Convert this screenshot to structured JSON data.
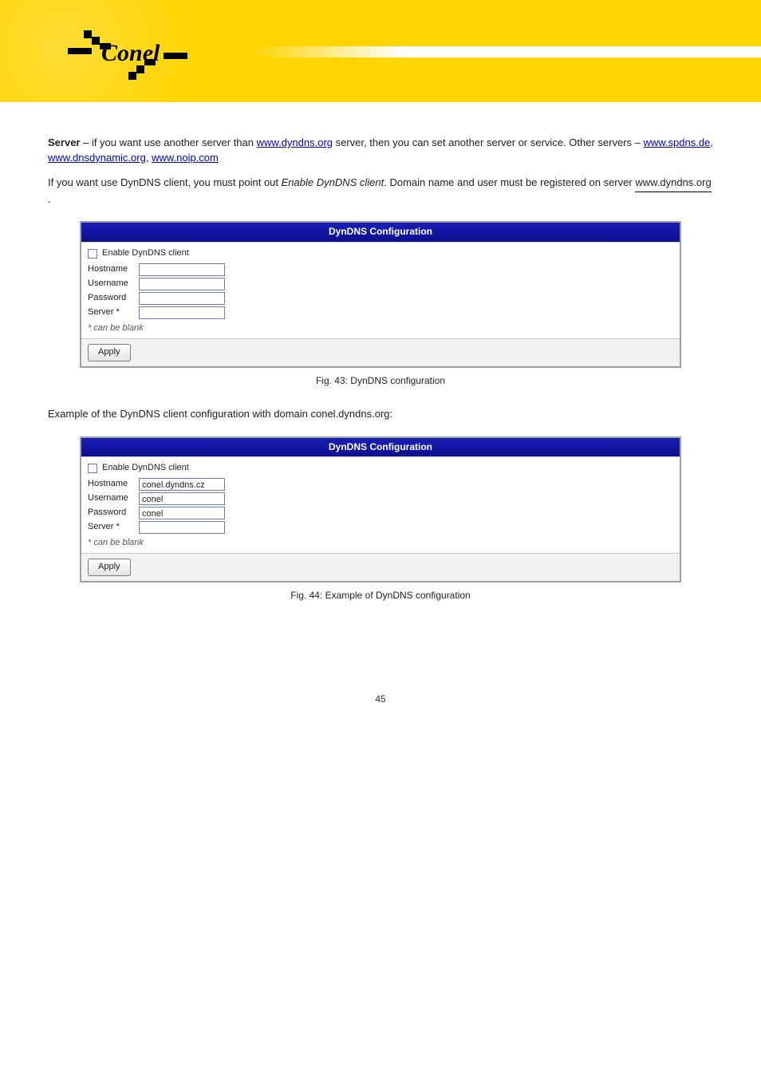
{
  "banner": {
    "logo_text": "Conel"
  },
  "intro": {
    "bold1": "Server",
    "text1": " – if you want use another server than ",
    "link1_text": "www.dyndns.org",
    "text1b": " server, then you can set another server or service. Other servers – ",
    "link2_text": "www.spdns.de",
    "text1c": ", ",
    "link3_text": "www.dnsdynamic.org",
    "text1d": ", ",
    "link4_text": "www.noip.com",
    "para2_a": "If you want use DynDNS client, you must point out ",
    "para2_i": "Enable DynDNS client",
    "para2_b": ". Domain name and user must be registered on server ",
    "para2_ref": "www.dyndns.org",
    "para2_c": "."
  },
  "shot1": {
    "title": "DynDNS Configuration",
    "enable_label": "Enable DynDNS client",
    "hostname_label": "Hostname",
    "username_label": "Username",
    "password_label": "Password",
    "server_label": "Server *",
    "hostname_value": "",
    "username_value": "",
    "password_value": "",
    "server_value": "",
    "note": "* can be blank",
    "apply": "Apply",
    "caption": "Fig. 43: DynDNS configuration"
  },
  "example": {
    "lead": "Example of the DynDNS client configuration with domain conel.dyndns.org:"
  },
  "shot2": {
    "title": "DynDNS Configuration",
    "enable_label": "Enable DynDNS client",
    "hostname_label": "Hostname",
    "username_label": "Username",
    "password_label": "Password",
    "server_label": "Server *",
    "hostname_value": "conel.dyndns.cz",
    "username_value": "conel",
    "password_value": "conel",
    "server_value": "",
    "note": "* can be blank",
    "apply": "Apply",
    "caption": "Fig. 44: Example of DynDNS configuration"
  },
  "footer": {
    "page_num": "45"
  }
}
